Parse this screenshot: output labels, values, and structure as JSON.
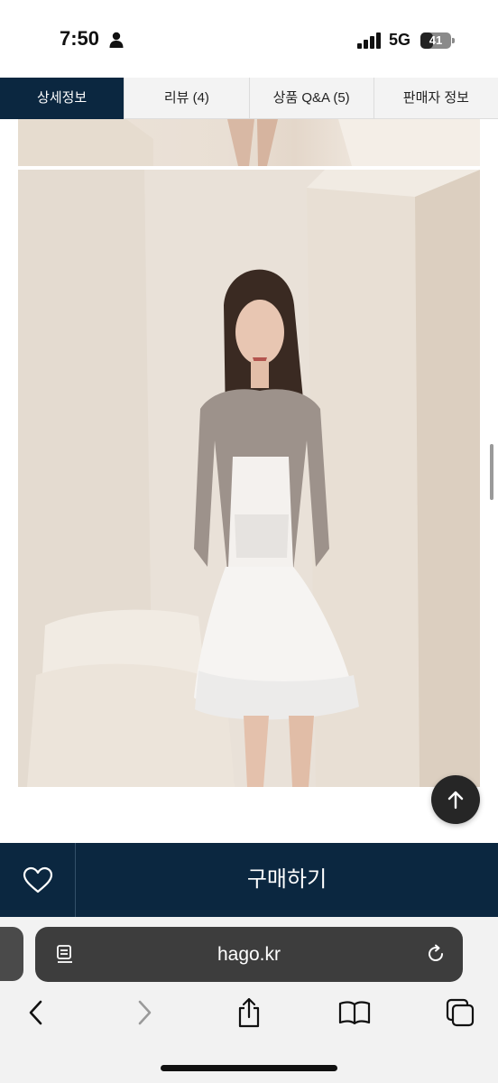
{
  "status_bar": {
    "time": "7:50",
    "network": "5G",
    "battery": "41",
    "battery_level": 0.41,
    "icons": [
      "person-icon",
      "signal-icon",
      "battery-icon"
    ]
  },
  "tabs": [
    {
      "label": "상세정보",
      "active": true
    },
    {
      "label": "리뷰 (4)",
      "active": false
    },
    {
      "label": "상품 Q&A (5)",
      "active": false
    },
    {
      "label": "판매자 정보",
      "active": false
    }
  ],
  "colors": {
    "navy": "#0b2740",
    "tab_bg": "#f3f3f3",
    "scroll_top_bg": "#262626",
    "address_bar_bg": "#3d3d3d"
  },
  "scroll_top_icon": "arrow-up-icon",
  "purchase_bar": {
    "wishlist_icon": "heart-icon",
    "buy_label": "구매하기"
  },
  "browser": {
    "url": "hago.kr",
    "address_icons": [
      "reader-mode-icon",
      "reload-icon"
    ],
    "toolbar_icons": [
      "back-icon",
      "forward-icon",
      "share-icon",
      "bookmarks-icon",
      "tabs-icon"
    ]
  }
}
